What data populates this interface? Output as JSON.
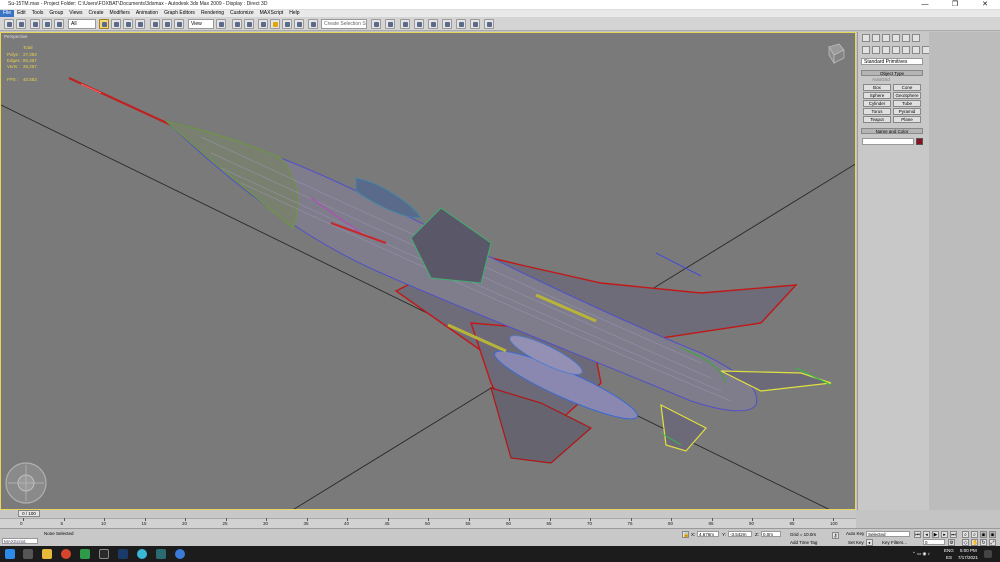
{
  "window": {
    "title": "Su-15TM.max     - Project Folder: C:\\Users\\FOXBAT\\Documents\\3dsmax     - Autodesk 3ds Max  2009           - Display : Direct 3D",
    "minimize": "—",
    "maximize": "❐",
    "close": "✕"
  },
  "menu": [
    "File",
    "Edit",
    "Tools",
    "Group",
    "Views",
    "Create",
    "Modifiers",
    "Animation",
    "Graph Editors",
    "Rendering",
    "Customize",
    "MAXScript",
    "Help"
  ],
  "toolbar": {
    "filter_value": "All",
    "refcoord_value": "View",
    "selset_placeholder": "Create Selection Set"
  },
  "viewport": {
    "label": "Perspective",
    "stats_header": "Total",
    "stats": [
      {
        "label": "Polys :",
        "value": "27,393"
      },
      {
        "label": "Edges :",
        "value": "80,467"
      },
      {
        "label": "Verts :",
        "value": "26,257"
      }
    ],
    "fps_label": "FPS :",
    "fps_value": "40.583"
  },
  "command_panel": {
    "dropdown_value": "Standard Primitives",
    "object_type_header": "Object Type",
    "autogrid_label": "AutoGrid",
    "buttons": [
      "Box",
      "Cone",
      "Sphere",
      "GeoSphere",
      "Cylinder",
      "Tube",
      "Torus",
      "Pyramid",
      "Teapot",
      "Plane"
    ],
    "name_color_header": "Name and Color",
    "object_color": "#8a1020"
  },
  "timeline": {
    "slider_label": "0 / 100",
    "ticks": [
      "0",
      "5",
      "10",
      "15",
      "20",
      "25",
      "30",
      "35",
      "40",
      "45",
      "50",
      "55",
      "60",
      "65",
      "70",
      "75",
      "80",
      "85",
      "90",
      "95",
      "100"
    ]
  },
  "status": {
    "maxscript_label": "MAXScript.",
    "selection_text": "None Selected",
    "x_label": "X:",
    "x_value": "4.676m",
    "y_label": "Y:",
    "y_value": "-3.542m",
    "z_label": "Z:",
    "z_value": "0.0m",
    "grid_text": "Grid = 10.0m",
    "add_time_tag": "Add Time Tag",
    "auto_key": "Auto Key",
    "set_key": "Set Key",
    "selected_value": "Selected",
    "key_filters": "Key Filters...",
    "frame_value": "0"
  },
  "taskbar": {
    "lang_top": "ENG",
    "lang_bottom": "ES",
    "time": "5:00 PM",
    "date": "7/17/2021"
  }
}
